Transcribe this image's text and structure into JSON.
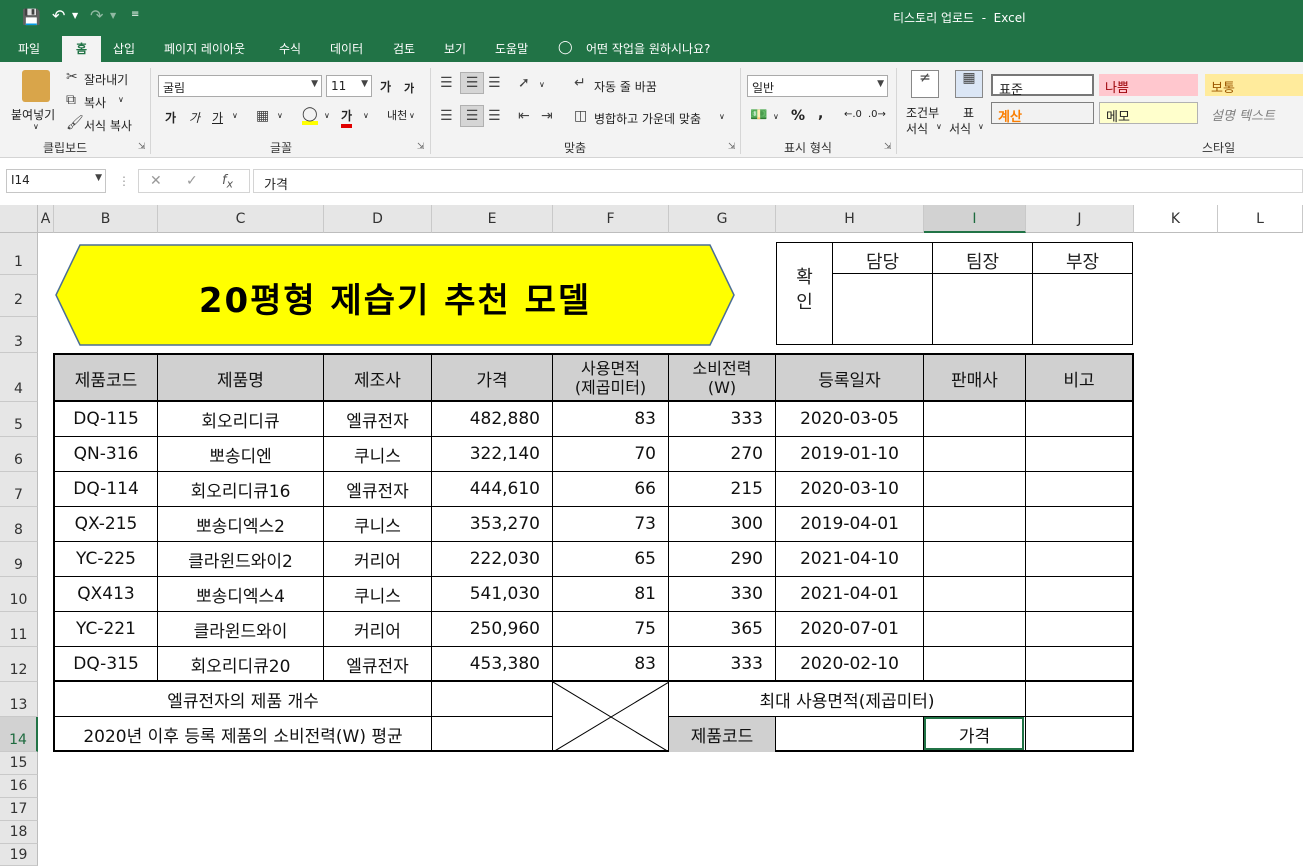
{
  "window": {
    "title": "티스토리 업로드  -  Excel"
  },
  "tabs": [
    "파일",
    "홈",
    "삽입",
    "페이지 레이아웃",
    "수식",
    "데이터",
    "검토",
    "보기",
    "도움말"
  ],
  "tell_me": "어떤 작업을 원하시나요?",
  "ribbon": {
    "clipboard": {
      "paste": "붙여넣기",
      "cut": "잘라내기",
      "copy": "복사",
      "format_painter": "서식 복사",
      "label": "클립보드"
    },
    "font": {
      "name": "굴림",
      "size": "11",
      "grow": "가",
      "shrink": "가",
      "bold": "가",
      "italic": "가",
      "underline": "가",
      "label": "글꼴"
    },
    "align": {
      "wrap": "자동 줄 바꿈",
      "merge": "병합하고 가운데 맞춤",
      "label": "맞춤"
    },
    "number": {
      "format": "일반",
      "percent": "%",
      "comma": ",",
      "label": "표시 형식"
    },
    "styles": {
      "cond": "조건부",
      "cond2": "서식",
      "table": "표",
      "table2": "서식",
      "label": "스타일",
      "cells": [
        "표준",
        "나쁨",
        "보통",
        "계산",
        "메모",
        "설명 텍스트"
      ]
    }
  },
  "formula_bar": {
    "name_box": "I14",
    "content": "가격"
  },
  "columns": [
    "A",
    "B",
    "C",
    "D",
    "E",
    "F",
    "G",
    "H",
    "I",
    "J",
    "K",
    "L"
  ],
  "rows": [
    "1",
    "2",
    "3",
    "4",
    "5",
    "6",
    "7",
    "8",
    "9",
    "10",
    "11",
    "12",
    "13",
    "14",
    "15",
    "16",
    "17",
    "18",
    "19"
  ],
  "sheet": {
    "title": "20평형 제습기 추천 모델",
    "approval": {
      "label": "확\n인",
      "roles": [
        "담당",
        "팀장",
        "부장"
      ]
    },
    "headers": [
      "제품코드",
      "제품명",
      "제조사",
      "가격",
      "사용면적\n(제곱미터)",
      "소비전력\n(W)",
      "등록일자",
      "판매사",
      "비고"
    ],
    "data": [
      [
        "DQ-115",
        "회오리디큐",
        "엘큐전자",
        "482,880",
        "83",
        "333",
        "2020-03-05"
      ],
      [
        "QN-316",
        "뽀송디엔",
        "쿠니스",
        "322,140",
        "70",
        "270",
        "2019-01-10"
      ],
      [
        "DQ-114",
        "회오리디큐16",
        "엘큐전자",
        "444,610",
        "66",
        "215",
        "2020-03-10"
      ],
      [
        "QX-215",
        "뽀송디엑스2",
        "쿠니스",
        "353,270",
        "73",
        "300",
        "2019-04-01"
      ],
      [
        "YC-225",
        "클라윈드와이2",
        "커리어",
        "222,030",
        "65",
        "290",
        "2021-04-10"
      ],
      [
        "QX413",
        "뽀송디엑스4",
        "쿠니스",
        "541,030",
        "81",
        "330",
        "2021-04-01"
      ],
      [
        "YC-221",
        "클라윈드와이",
        "커리어",
        "250,960",
        "75",
        "365",
        "2020-07-01"
      ],
      [
        "DQ-315",
        "회오리디큐20",
        "엘큐전자",
        "453,380",
        "83",
        "333",
        "2020-02-10"
      ]
    ],
    "summary": {
      "count_label": "엘큐전자의 제품 개수",
      "avg_label": "2020년 이후 등록 제품의 소비전력(W) 평균",
      "max_label": "최대 사용면적(제곱미터)",
      "code_label": "제품코드",
      "price_label": "가격"
    }
  },
  "colors": {
    "accent": "#217346",
    "title_shape": "#ffff00"
  }
}
